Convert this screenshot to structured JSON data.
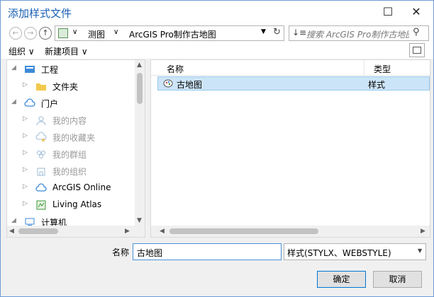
{
  "window": {
    "title": "添加样式文件",
    "minimize": "—",
    "maximize": "☐",
    "close": "✕"
  },
  "address": {
    "crumb1": "测图",
    "crumb2": "ArcGIS Pro制作古地图",
    "search_placeholder": "搜索 ArcGIS Pro制作古地图"
  },
  "toolbar": {
    "organize": "组织 ∨",
    "new_item": "新建项目 ∨"
  },
  "sidebar": {
    "items": [
      {
        "label": "工程",
        "icon": "project-icon",
        "state": "enabled"
      },
      {
        "label": "文件夹",
        "icon": "folder-icon",
        "state": "enabled"
      },
      {
        "label": "门户",
        "icon": "cloud-icon",
        "state": "enabled"
      },
      {
        "label": "我的内容",
        "icon": "user-icon",
        "state": "disabled"
      },
      {
        "label": "我的收藏夹",
        "icon": "star-icon",
        "state": "disabled"
      },
      {
        "label": "我的群组",
        "icon": "group-icon",
        "state": "disabled"
      },
      {
        "label": "我的组织",
        "icon": "organization-icon",
        "state": "disabled"
      },
      {
        "label": "ArcGIS Online",
        "icon": "cloud-icon",
        "state": "enabled"
      },
      {
        "label": "Living Atlas",
        "icon": "atlas-icon",
        "state": "enabled"
      },
      {
        "label": "计算机",
        "icon": "computer-icon",
        "state": "enabled"
      }
    ]
  },
  "filelist": {
    "columns": [
      "名称",
      "类型"
    ],
    "rows": [
      {
        "name": "古地图",
        "type": "样式",
        "icon": "style-icon"
      }
    ]
  },
  "footer": {
    "name_label": "名称",
    "name_value": "古地图",
    "type_value": "样式(STYLX、WEBSTYLE)",
    "ok_label": "确定",
    "cancel_label": "取消"
  },
  "colors": {
    "accent": "#1a5fb4",
    "selection": "#cce4f7",
    "selection_border": "#99c9ef"
  }
}
